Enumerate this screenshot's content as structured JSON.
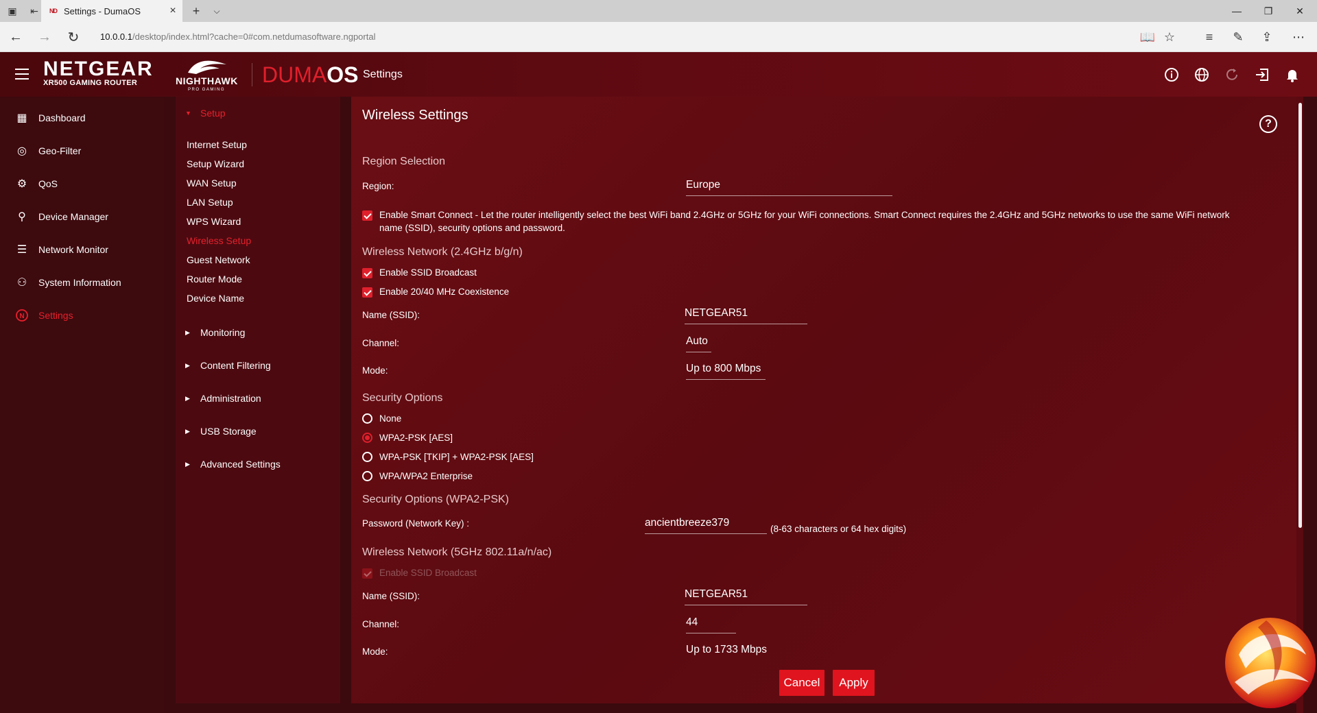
{
  "browser": {
    "tab_title": "Settings - DumaOS",
    "tab_favicon": "ND",
    "tab_close": "×",
    "new_tab": "+",
    "tab_list": "⌵",
    "url_host": "10.0.0.1",
    "url_path": "/desktop/index.html?cache=0#com.netdumasoftware.ngportal",
    "win_minimize": "—",
    "win_restore": "❐",
    "win_close": "✕"
  },
  "header": {
    "brand": "NETGEAR",
    "brand_sub": "XR500 GAMING ROUTER",
    "nighthawk": "NIGHTHAWK",
    "nighthawk_sub": "PRO GAMING",
    "duma_light": "DUMA",
    "duma_bold": "OS",
    "title": "Settings",
    "icons": [
      "info-icon",
      "globe-icon",
      "refresh-icon",
      "logout-icon",
      "bell-icon"
    ]
  },
  "sidebar": {
    "items": [
      {
        "label": "Dashboard",
        "icon": "dashboard-icon"
      },
      {
        "label": "Geo-Filter",
        "icon": "geofilter-icon"
      },
      {
        "label": "QoS",
        "icon": "qos-icon"
      },
      {
        "label": "Device Manager",
        "icon": "device-manager-icon"
      },
      {
        "label": "Network Monitor",
        "icon": "network-monitor-icon"
      },
      {
        "label": "System Information",
        "icon": "system-information-icon"
      },
      {
        "label": "Settings",
        "icon": "settings-icon"
      }
    ]
  },
  "submenu": {
    "setup_label": "Setup",
    "setup_links": [
      "Internet Setup",
      "Setup Wizard",
      "WAN Setup",
      "LAN Setup",
      "WPS Wizard",
      "Wireless Setup",
      "Guest Network",
      "Router Mode",
      "Device Name"
    ],
    "sections": [
      "Monitoring",
      "Content Filtering",
      "Administration",
      "USB Storage",
      "Advanced Settings"
    ]
  },
  "main": {
    "title": "Wireless Settings",
    "region_heading": "Region Selection",
    "region_label": "Region:",
    "region_value": "Europe",
    "smart_connect_line1": "Enable Smart Connect - Let the router intelligently select the best WiFi band 2.4GHz or 5GHz for your WiFi connections. Smart Connect requires the 2.4GHz and 5GHz networks to use the same WiFi network",
    "smart_connect_line2": "name (SSID), security options and password.",
    "net24_heading": "Wireless Network (2.4GHz b/g/n)",
    "net24_ssid_broadcast": "Enable SSID Broadcast",
    "net24_coexistence": "Enable 20/40 MHz Coexistence",
    "name_label": "Name (SSID):",
    "net24_ssid": "NETGEAR51",
    "channel_label": "Channel:",
    "net24_channel": "Auto",
    "mode_label": "Mode:",
    "net24_mode": "Up to 800 Mbps",
    "security_heading": "Security Options",
    "security_options": [
      "None",
      "WPA2-PSK [AES]",
      "WPA-PSK [TKIP] + WPA2-PSK [AES]",
      "WPA/WPA2 Enterprise"
    ],
    "security_selected": "WPA2-PSK [AES]",
    "security_psk_heading": "Security Options (WPA2-PSK)",
    "password_label": "Password (Network Key) :",
    "password_value": "ancientbreeze379",
    "password_hint": "(8-63 characters or 64 hex digits)",
    "net5_heading": "Wireless Network (5GHz 802.11a/n/ac)",
    "net5_ssid_broadcast": "Enable SSID Broadcast",
    "net5_ssid": "NETGEAR51",
    "net5_channel": "44",
    "net5_mode": "Up to 1733 Mbps",
    "cancel_label": "Cancel",
    "apply_label": "Apply"
  }
}
